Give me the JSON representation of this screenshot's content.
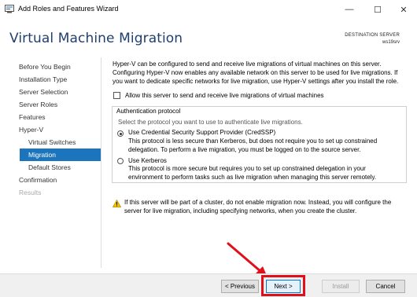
{
  "window": {
    "title": "Add Roles and Features Wizard",
    "controls": {
      "minimize": "—",
      "maximize": "☐",
      "close": "✕"
    }
  },
  "header": {
    "page_title": "Virtual Machine Migration",
    "destination_label": "DESTINATION SERVER",
    "destination_server": "ws19srv"
  },
  "nav": {
    "items": [
      {
        "label": "Before You Begin",
        "state": "normal",
        "level": 0
      },
      {
        "label": "Installation Type",
        "state": "normal",
        "level": 0
      },
      {
        "label": "Server Selection",
        "state": "normal",
        "level": 0
      },
      {
        "label": "Server Roles",
        "state": "normal",
        "level": 0
      },
      {
        "label": "Features",
        "state": "normal",
        "level": 0
      },
      {
        "label": "Hyper-V",
        "state": "normal",
        "level": 0
      },
      {
        "label": "Virtual Switches",
        "state": "normal",
        "level": 1
      },
      {
        "label": "Migration",
        "state": "selected",
        "level": 1
      },
      {
        "label": "Default Stores",
        "state": "normal",
        "level": 1
      },
      {
        "label": "Confirmation",
        "state": "normal",
        "level": 0
      },
      {
        "label": "Results",
        "state": "disabled",
        "level": 0
      }
    ]
  },
  "main": {
    "intro_lines": [
      "Hyper-V can be configured to send and receive live migrations of virtual machines on this server.",
      "Configuring Hyper-V now enables any available network on this server to be used for live migrations. If",
      "you want to dedicate specific networks for live migration, use Hyper-V settings after you install the role."
    ],
    "allow_checkbox_label": "Allow this server to send and receive live migrations of virtual machines",
    "allow_checked": false,
    "auth_group_title": "Authentication protocol",
    "auth_hint": "Select the protocol you want to use to authenticate live migrations.",
    "options": [
      {
        "title": "Use Credential Security Support Provider (CredSSP)",
        "selected": true,
        "desc_lines": [
          "This protocol is less secure than Kerberos, but does not require you to set up constrained",
          "delegation. To perform a live migration, you must be logged on to the source server."
        ]
      },
      {
        "title": "Use Kerberos",
        "selected": false,
        "desc_lines": [
          "This protocol is more secure but requires you to set up constrained delegation in your",
          "environment to perform tasks such as live migration when managing this server remotely."
        ]
      }
    ],
    "warning_icon": "warning-icon",
    "warning_lines": [
      "If this server will be part of a cluster, do not enable migration now. Instead, you will configure the",
      "server for live migration, including specifying networks, when you create the cluster."
    ]
  },
  "footer": {
    "previous_label": "< Previous",
    "next_label": "Next >",
    "install_label": "Install",
    "cancel_label": "Cancel"
  },
  "colors": {
    "accent": "#1c75bc",
    "title": "#1f3f6e",
    "highlight": "#e0101a"
  }
}
